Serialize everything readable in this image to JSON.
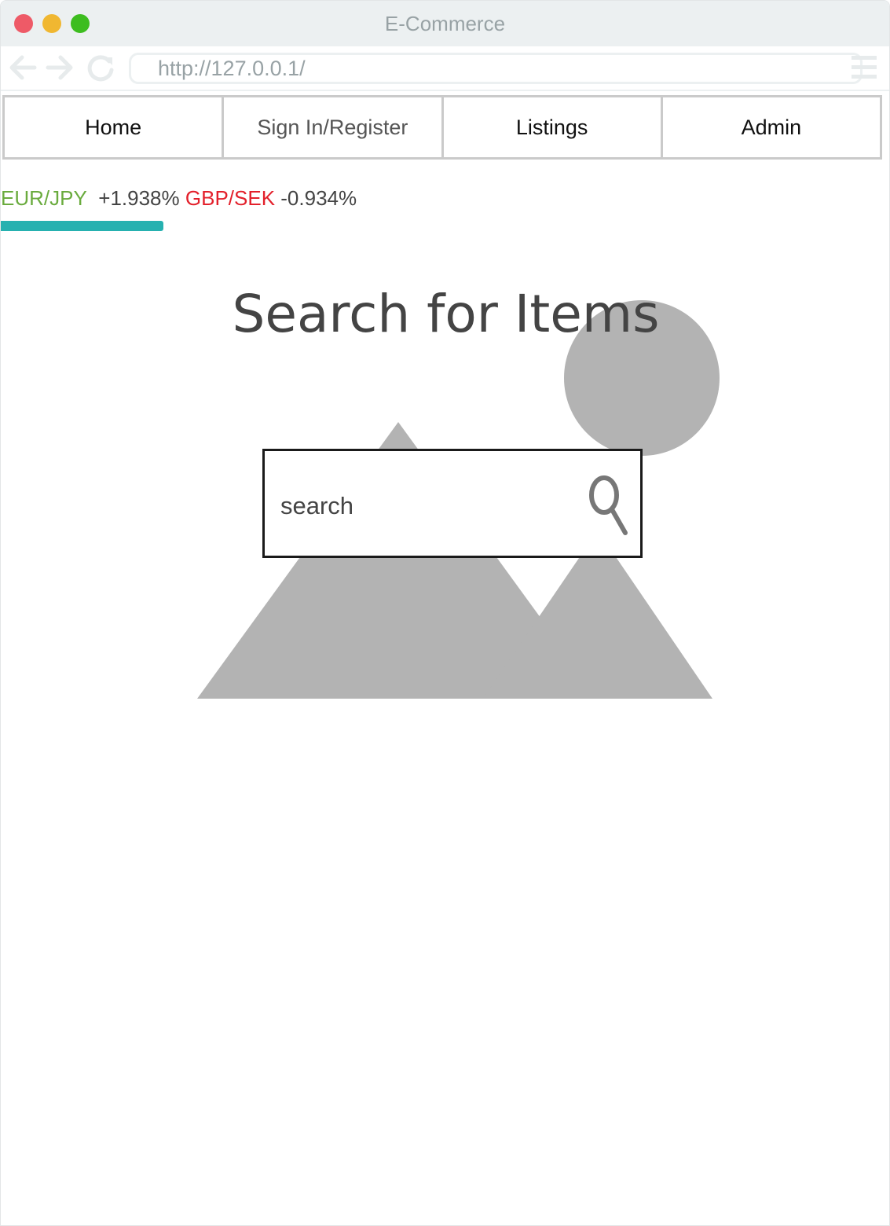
{
  "window": {
    "title": "E-Commerce"
  },
  "browser": {
    "url": "http://127.0.0.1/"
  },
  "nav": {
    "items": [
      {
        "label": "Home"
      },
      {
        "label": "Sign In/Register"
      },
      {
        "label": "Listings"
      },
      {
        "label": "Admin"
      }
    ]
  },
  "ticker": {
    "items": [
      {
        "pair": "EUR/JPY",
        "change": "+1.938%",
        "pair_color": "#6aab3e"
      },
      {
        "pair": "GBP/SEK",
        "change": "-0.934%",
        "pair_color": "#e3202b"
      }
    ],
    "progress": 0.43
  },
  "main": {
    "heading": "Search for Items",
    "search": {
      "placeholder": "search"
    }
  },
  "icons": [
    "back-arrow-icon",
    "forward-arrow-icon",
    "reload-icon",
    "menu-icon",
    "search-icon",
    "image-placeholder-icon"
  ]
}
